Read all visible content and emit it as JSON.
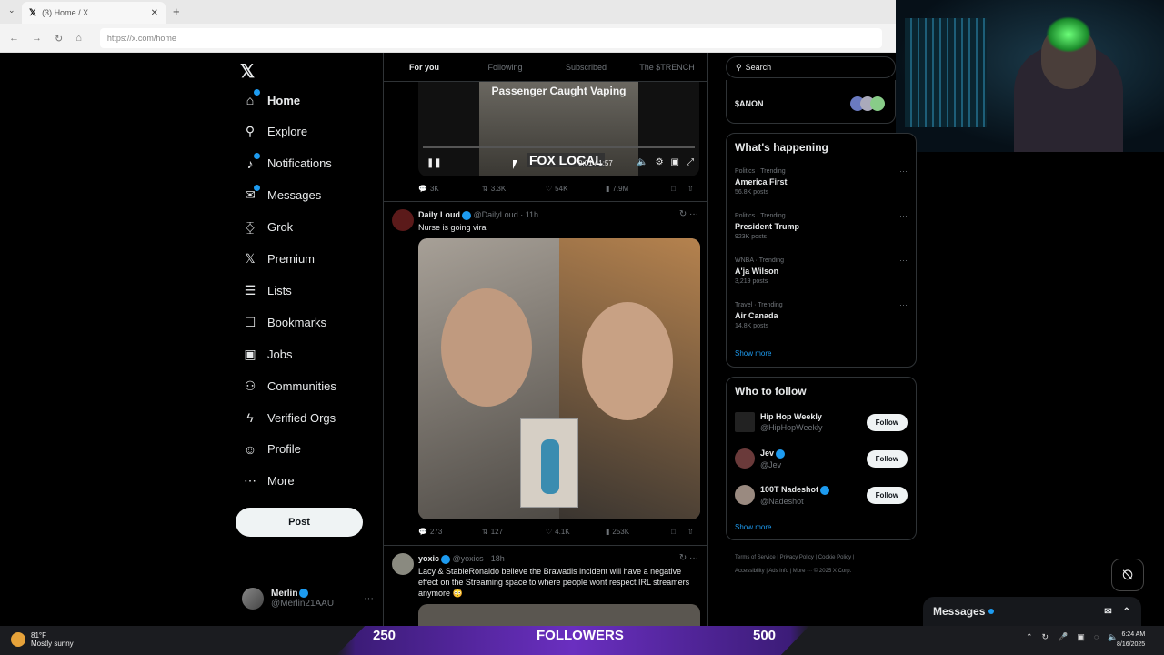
{
  "browser": {
    "tab_title": "(3) Home / X",
    "url": "https://x.com/home"
  },
  "nav": {
    "items": [
      {
        "label": "Home",
        "icon": "home-icon",
        "active": true,
        "dot": true
      },
      {
        "label": "Explore",
        "icon": "search-icon"
      },
      {
        "label": "Notifications",
        "icon": "bell-icon",
        "dot": true
      },
      {
        "label": "Messages",
        "icon": "envelope-icon",
        "dot": true
      },
      {
        "label": "Grok",
        "icon": "grok-icon"
      },
      {
        "label": "Premium",
        "icon": "x-icon"
      },
      {
        "label": "Lists",
        "icon": "list-icon"
      },
      {
        "label": "Bookmarks",
        "icon": "bookmark-icon"
      },
      {
        "label": "Jobs",
        "icon": "briefcase-icon"
      },
      {
        "label": "Communities",
        "icon": "people-icon"
      },
      {
        "label": "Verified Orgs",
        "icon": "lightning-icon"
      },
      {
        "label": "Profile",
        "icon": "person-icon"
      },
      {
        "label": "More",
        "icon": "more-circle-icon"
      }
    ],
    "post_label": "Post",
    "me": {
      "name": "Merlin",
      "handle": "@Merlin21AAU"
    }
  },
  "feed": {
    "tabs": [
      "For you",
      "Following",
      "Subscribed",
      "The $TRENCH"
    ],
    "video": {
      "title": "Passenger Caught Vaping",
      "brand": "FOX LOCAL",
      "time": "0:01 / 1:57"
    },
    "video_actions": {
      "replies": "3K",
      "reposts": "3.3K",
      "likes": "54K",
      "views": "7.9M"
    },
    "tweet1": {
      "name": "Daily Loud",
      "handle": "@DailyLoud",
      "time": "· 11h",
      "text": "Nurse is going viral",
      "replies": "273",
      "reposts": "127",
      "likes": "4.1K",
      "views": "253K"
    },
    "tweet2": {
      "name": "yoxic",
      "handle": "@yoxics",
      "time": "· 18h",
      "text": "Lacy & StableRonaldo believe the Brawadis incident will have a negative effect on the Streaming space to where people wont respect IRL streamers anymore 😳"
    }
  },
  "right": {
    "search_placeholder": "Search",
    "anon_label": "$ANON",
    "happening_title": "What's happening",
    "trends": [
      {
        "cat": "Politics · Trending",
        "name": "America First",
        "count": "56.8K posts"
      },
      {
        "cat": "Politics · Trending",
        "name": "President Trump",
        "count": "923K posts"
      },
      {
        "cat": "WNBA · Trending",
        "name": "A'ja Wilson",
        "count": "3,219 posts"
      },
      {
        "cat": "Travel · Trending",
        "name": "Air Canada",
        "count": "14.8K posts"
      }
    ],
    "show_more": "Show more",
    "wtf_title": "Who to follow",
    "follow_label": "Follow",
    "wtf": [
      {
        "name": "Hip Hop Weekly",
        "handle": "@HipHopWeekly"
      },
      {
        "name": "Jev",
        "handle": "@Jev"
      },
      {
        "name": "100T Nadeshot",
        "handle": "@Nadeshot"
      }
    ],
    "footer_line1": "Terms of Service  |  Privacy Policy  |  Cookie Policy  |",
    "footer_line2": "Accessibility  |  Ads info  |  More ···  © 2025 X Corp.",
    "messages_label": "Messages"
  },
  "overlay": {
    "count1": "250",
    "label": "FOLLOWERS",
    "count2": "500"
  },
  "taskbar": {
    "temp": "81°F",
    "weather": "Mostly sunny",
    "time": "6:24 AM",
    "date": "8/16/2025"
  }
}
